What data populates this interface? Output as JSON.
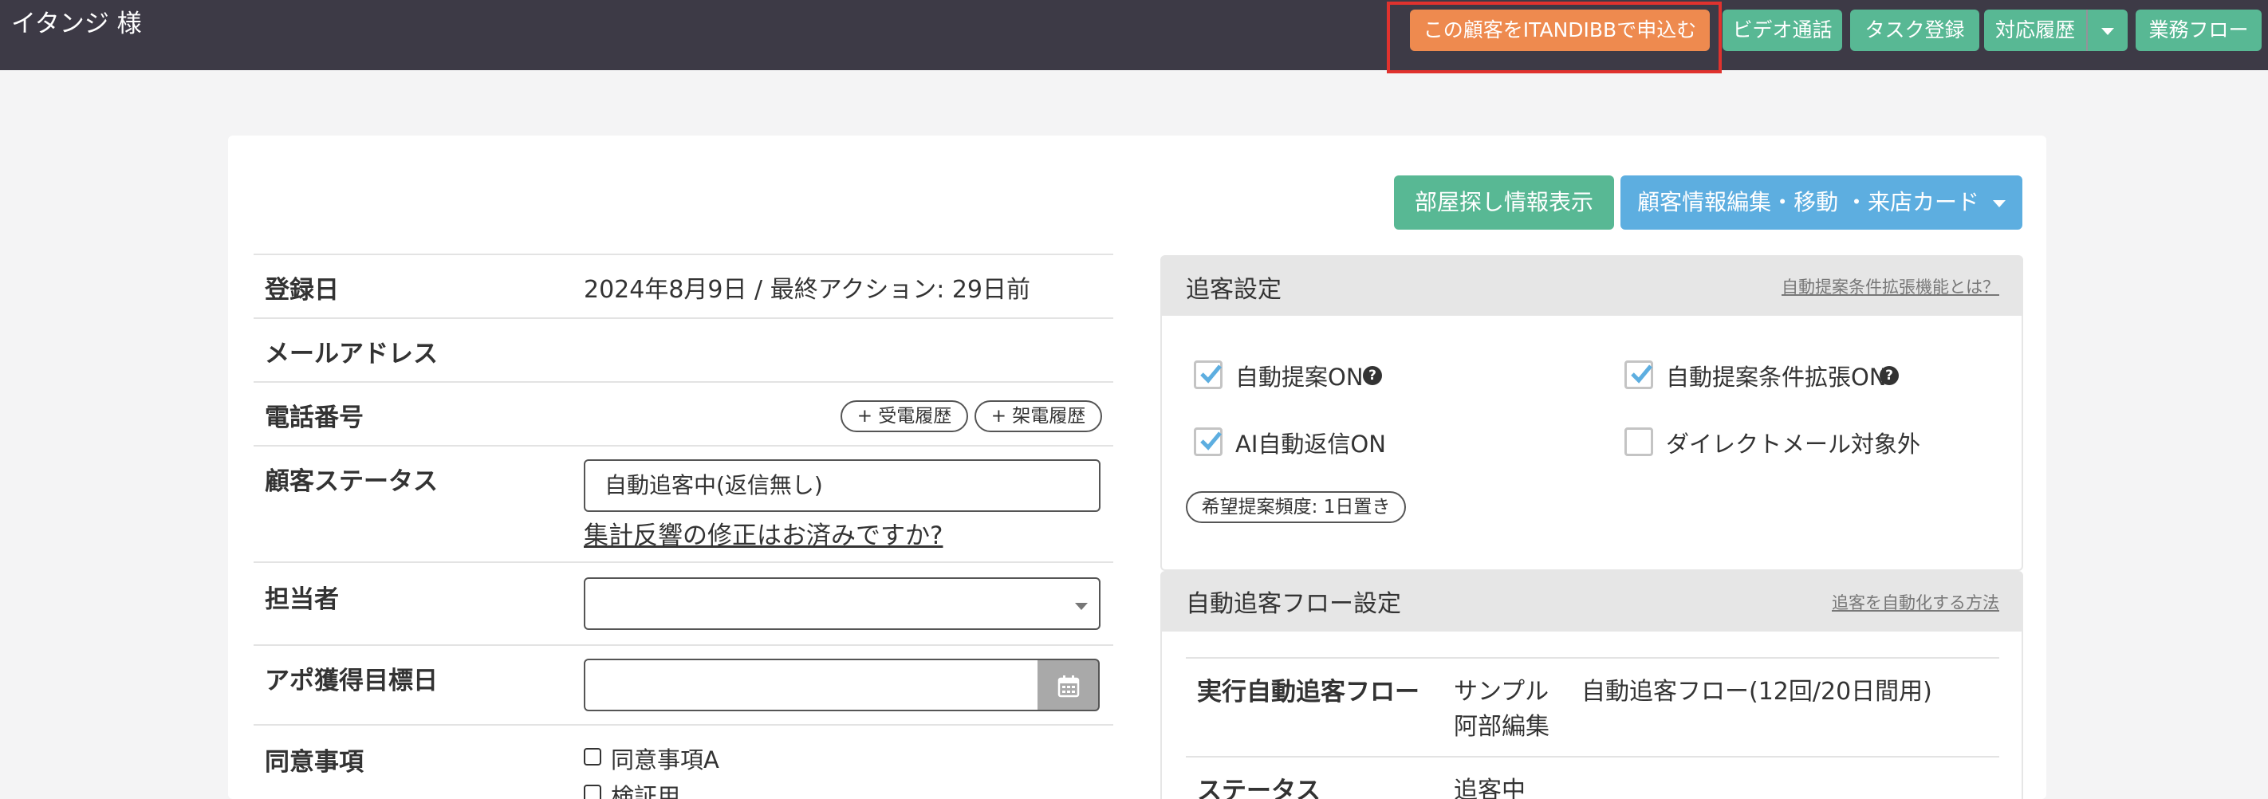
{
  "header": {
    "customer_name": "イタンジ 様",
    "apply_button": "この顧客をITANDIBBで申込む",
    "video_call": "ビデオ通話",
    "task_register": "タスク登録",
    "history": "対応履歴",
    "workflow": "業務フロー"
  },
  "actions": {
    "room_search": "部屋探し情報表示",
    "customer_edit": "顧客情報編集・移動 ・来店カード"
  },
  "details": {
    "registered_label": "登録日",
    "registered_value": "2024年8月9日 / 最終アクション: 29日前",
    "email_label": "メールアドレス",
    "phone_label": "電話番号",
    "incoming_history": "+ 受電履歴",
    "outgoing_history": "+ 架電履歴",
    "status_label": "顧客ステータス",
    "status_value": "自動追客中(返信無し)",
    "status_link": "集計反響の修正はお済みですか?",
    "assignee_label": "担当者",
    "appointment_label": "アポ獲得目標日",
    "consent_label": "同意事項",
    "consent_a": "同意事項A",
    "consent_b": "検証用"
  },
  "followup_settings": {
    "title": "追客設定",
    "help": "自動提案条件拡張機能とは？",
    "auto_suggest": "自動提案ON",
    "auto_suggest_ext": "自動提案条件拡張ON",
    "ai_reply": "AI自動返信ON",
    "direct_mail_exclude": "ダイレクトメール対象外",
    "frequency": "希望提案頻度: 1日置き"
  },
  "auto_flow": {
    "title": "自動追客フロー設定",
    "help": "追客を自動化する方法",
    "flow_label": "実行自動追客フロー",
    "flow_value_line1": "サンプル",
    "flow_value_line2": "阿部編集",
    "flow_value_name": "自動追客フロー(12回/20日間用)",
    "status_label": "ステータス",
    "status_value": "追客中"
  },
  "checkbox_states": {
    "auto_suggest": true,
    "auto_suggest_ext": true,
    "ai_reply": true,
    "direct_mail_exclude": false
  },
  "colors": {
    "topbar": "#3d3a46",
    "orange": "#ee8a4f",
    "green": "#58b894",
    "blue": "#5daee0",
    "highlight": "#e0322e"
  },
  "icons": [
    "question-icon",
    "calendar-icon",
    "check-icon",
    "caret-down-icon"
  ]
}
